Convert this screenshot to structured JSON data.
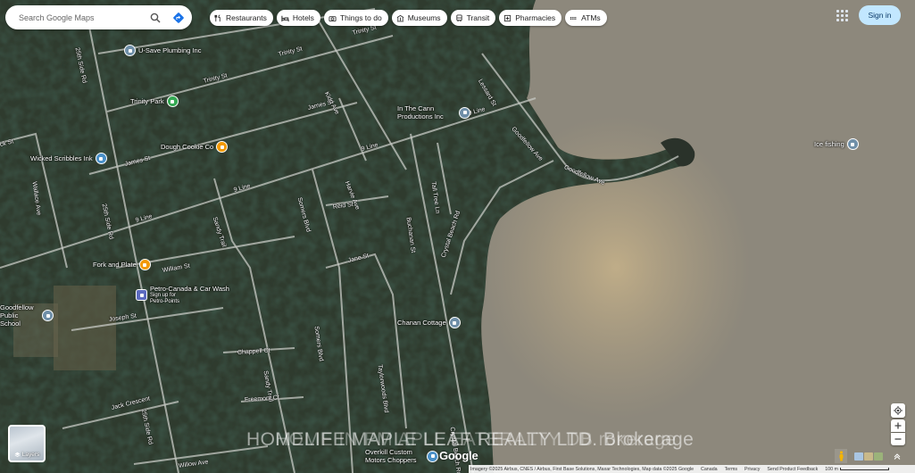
{
  "search": {
    "placeholder": "Search Google Maps"
  },
  "chips": [
    {
      "label": "Restaurants",
      "icon": "fork-knife-icon"
    },
    {
      "label": "Hotels",
      "icon": "bed-icon"
    },
    {
      "label": "Things to do",
      "icon": "camera-icon"
    },
    {
      "label": "Museums",
      "icon": "museum-icon"
    },
    {
      "label": "Transit",
      "icon": "train-icon"
    },
    {
      "label": "Pharmacies",
      "icon": "pharmacy-icon"
    },
    {
      "label": "ATMs",
      "icon": "atm-icon"
    }
  ],
  "header": {
    "sign_in_label": "Sign in"
  },
  "streets": [
    {
      "name": "Trinity St"
    },
    {
      "name": "Trinity St"
    },
    {
      "name": "Trinity St"
    },
    {
      "name": "James St"
    },
    {
      "name": "James St"
    },
    {
      "name": "9 Line"
    },
    {
      "name": "9 Line"
    },
    {
      "name": "9 Line"
    },
    {
      "name": "9 Line"
    },
    {
      "name": "25th Side Rd"
    },
    {
      "name": "25th Side Rd"
    },
    {
      "name": "25th Side Rd"
    },
    {
      "name": "Kidd Ave"
    },
    {
      "name": "Harvie Ave"
    },
    {
      "name": "Somers Blvd"
    },
    {
      "name": "Somers Blvd"
    },
    {
      "name": "Reid St"
    },
    {
      "name": "Sandy Trail"
    },
    {
      "name": "Sandy Trail"
    },
    {
      "name": "Buchanan St"
    },
    {
      "name": "Tall Tree Ln"
    },
    {
      "name": "Crystal Beach Rd"
    },
    {
      "name": "Crystal Beach Rd"
    },
    {
      "name": "Jane St"
    },
    {
      "name": "William St"
    },
    {
      "name": "Joseph St"
    },
    {
      "name": "Chappell Ct"
    },
    {
      "name": "Freemont Ct"
    },
    {
      "name": "Jack Crescent"
    },
    {
      "name": "Willow Ave"
    },
    {
      "name": "Taylorwoods Blvd"
    },
    {
      "name": "Goodfellow Ave"
    },
    {
      "name": "Goodfellow Ave"
    },
    {
      "name": "Lessard St"
    },
    {
      "name": "Wallace Ave"
    },
    {
      "name": "ck St"
    }
  ],
  "places": [
    {
      "name": "U-Save Plumbing Inc",
      "icon": "store-pin-icon",
      "color": "#6f8fa8"
    },
    {
      "name": "Trinity Park",
      "icon": "park-pin-icon",
      "color": "#34a853"
    },
    {
      "name": "In The Cann Productions Inc",
      "icon": "store-pin-icon",
      "color": "#6f8fa8"
    },
    {
      "name": "Dough Cookie Co",
      "icon": "food-pin-icon",
      "color": "#f29900"
    },
    {
      "name": "Wicked Scribbles Ink",
      "icon": "shopping-pin-icon",
      "color": "#4a90c8"
    },
    {
      "name": "Ice fishing",
      "icon": "activity-pin-icon",
      "color": "#6f8fa8"
    },
    {
      "name": "Fork and Plate",
      "icon": "food-pin-icon",
      "color": "#f29900"
    },
    {
      "name": "Petro-Canada & Car Wash",
      "icon": "gas-pin-icon",
      "color": "#5c6bc0"
    },
    {
      "name": "Sign up for Petro-Points",
      "icon": "",
      "color": ""
    },
    {
      "name": "Goodfellow Public School",
      "icon": "school-pin-icon",
      "color": "#6f8fa8"
    },
    {
      "name": "Chanan Cottage",
      "icon": "lodging-pin-icon",
      "color": "#6f8fa8"
    },
    {
      "name": "Overkill Custom Motors Choppers",
      "icon": "service-pin-icon",
      "color": "#4a90c8"
    }
  ],
  "watermark": {
    "text_a": "HOMELIFE MAPLE LEAF REALTY LTD. Brokerage",
    "text_b": "HOME IN PM APLL EATERALTY DB rokerage"
  },
  "logo": {
    "text": "Google"
  },
  "footer": {
    "attribution": "Imagery ©2025 Airbus, CNES / Airbus, First Base Solutions, Maxar Technologies, Map data ©2025 Google",
    "links": [
      "Canada",
      "Terms",
      "Privacy",
      "Send Product Feedback"
    ],
    "scale_label": "100 m"
  },
  "layers_label": "Layers",
  "colors": {
    "accent": "#c2e7ff",
    "directions": "#1a73e8",
    "water": "#8c8577"
  }
}
